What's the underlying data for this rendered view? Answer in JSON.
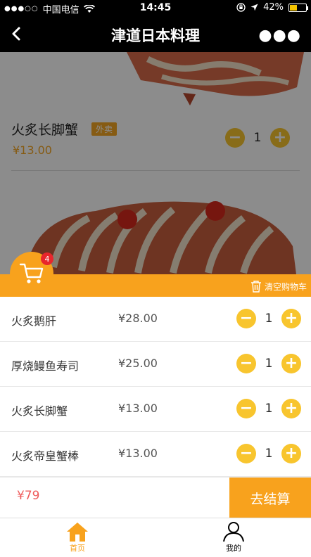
{
  "status_bar": {
    "carrier": "中国电信",
    "time": "14:45",
    "battery": "42%"
  },
  "nav": {
    "title": "津道日本料理"
  },
  "featured_item": {
    "name": "火炙长脚蟹",
    "tag": "外卖",
    "price": "¥13.00",
    "quantity": "1"
  },
  "cart": {
    "badge_count": "4",
    "clear_label": "清空购物车",
    "items": [
      {
        "name": "火炙鹅肝",
        "price": "¥28.00",
        "quantity": "1"
      },
      {
        "name": "厚烧鳗鱼寿司",
        "price": "¥25.00",
        "quantity": "1"
      },
      {
        "name": "火炙长脚蟹",
        "price": "¥13.00",
        "quantity": "1"
      },
      {
        "name": "火炙帝皇蟹棒",
        "price": "¥13.00",
        "quantity": "1"
      }
    ],
    "total": "¥79",
    "checkout_label": "去结算"
  },
  "tabbar": {
    "home_label": "首页",
    "me_label": "我的"
  },
  "colors": {
    "accent": "#f8a21d",
    "button": "#f8c52e",
    "badge": "#e8262c",
    "total": "#ef5b5b"
  }
}
